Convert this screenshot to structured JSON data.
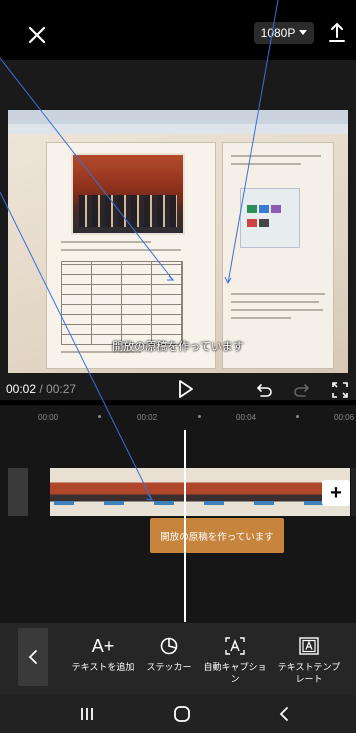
{
  "header": {
    "resolution": "1080P"
  },
  "preview": {
    "caption": "開放の原稿を作っています"
  },
  "playback": {
    "current_time": "00:02",
    "total_time": "/ 00:27"
  },
  "timeline": {
    "ticks": [
      "00:00",
      "00:02",
      "00:04",
      "00:06"
    ],
    "text_clip_label": "開放の原稿を作っています",
    "add_clip_label": "+"
  },
  "toolbar": {
    "items": [
      {
        "icon": "add-text-icon",
        "glyph": "A+",
        "label": "テキストを追加"
      },
      {
        "icon": "sticker-icon",
        "glyph": "",
        "label": "ステッカー"
      },
      {
        "icon": "auto-caption-icon",
        "glyph": "[A]",
        "label": "自動キャプション"
      },
      {
        "icon": "text-template-icon",
        "glyph": "A",
        "label": "テキストテンプレート"
      }
    ]
  },
  "colors": {
    "text_clip": "#c7843d",
    "annotation_line": "#3b6fd8"
  }
}
